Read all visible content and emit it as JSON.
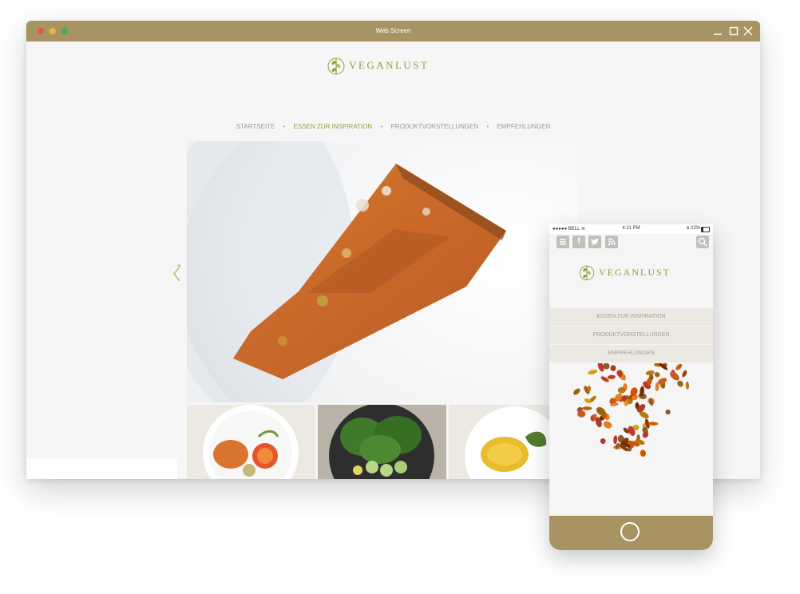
{
  "window": {
    "title": "Web Screen"
  },
  "site": {
    "name": "VEGANLUST"
  },
  "nav": {
    "items": [
      {
        "label": "STARTSEITE"
      },
      {
        "label": "ESSEN ZUR INSPIRATION"
      },
      {
        "label": "PRODUKTVORSTELLUNGEN"
      },
      {
        "label": "EMPFEHLUNGEN"
      }
    ],
    "active_index": 1
  },
  "phone": {
    "carrier": "BELL",
    "time": "4:21 PM",
    "battery": "22%",
    "menu": [
      {
        "label": "ESSEN ZUR INSPIRATION"
      },
      {
        "label": "PRODUKTVORSTELLUNGEN"
      },
      {
        "label": "EMPFEHLUNGEN"
      }
    ]
  },
  "colors": {
    "brand": "#a89463",
    "accent": "#8fa03a",
    "nav_text": "#9a9a9a"
  },
  "icons": [
    "close-icon",
    "maximize-icon",
    "minimize-icon",
    "chevron-left-icon",
    "menu-icon",
    "facebook-icon",
    "twitter-icon",
    "rss-icon",
    "search-icon"
  ]
}
